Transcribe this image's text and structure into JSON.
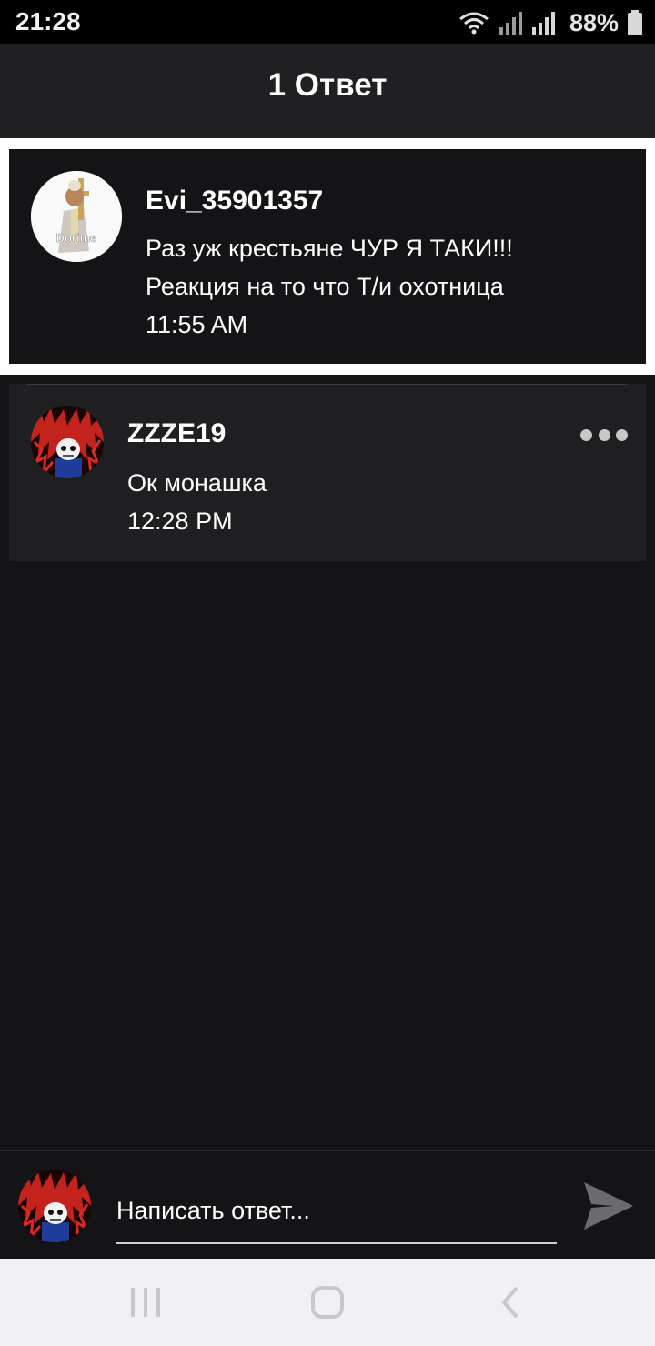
{
  "status_bar": {
    "time": "21:28",
    "battery": "88%"
  },
  "header": {
    "title": "1 Ответ"
  },
  "parent_comment": {
    "username": "Evi_35901357",
    "lines": [
      "Раз уж крестьяне ЧУР Я ТАКИ!!!",
      "Реакция на то что Т/и охотница"
    ],
    "time": "11:55 AM",
    "avatar_caption": "Dorime"
  },
  "reply": {
    "username": "ZZZE19",
    "text": "Ок монашка",
    "time": "12:28 PM"
  },
  "composer": {
    "placeholder": "Написать ответ..."
  },
  "colors": {
    "background": "#141316",
    "header": "#202022",
    "reply_card": "#1f1e21",
    "nav_bar": "#f1f0f2",
    "send_icon": "#6b6b6d"
  },
  "icons": [
    "wifi-icon",
    "signal-icon",
    "battery-icon",
    "more-icon",
    "send-icon",
    "recents-icon",
    "home-icon",
    "back-icon"
  ]
}
